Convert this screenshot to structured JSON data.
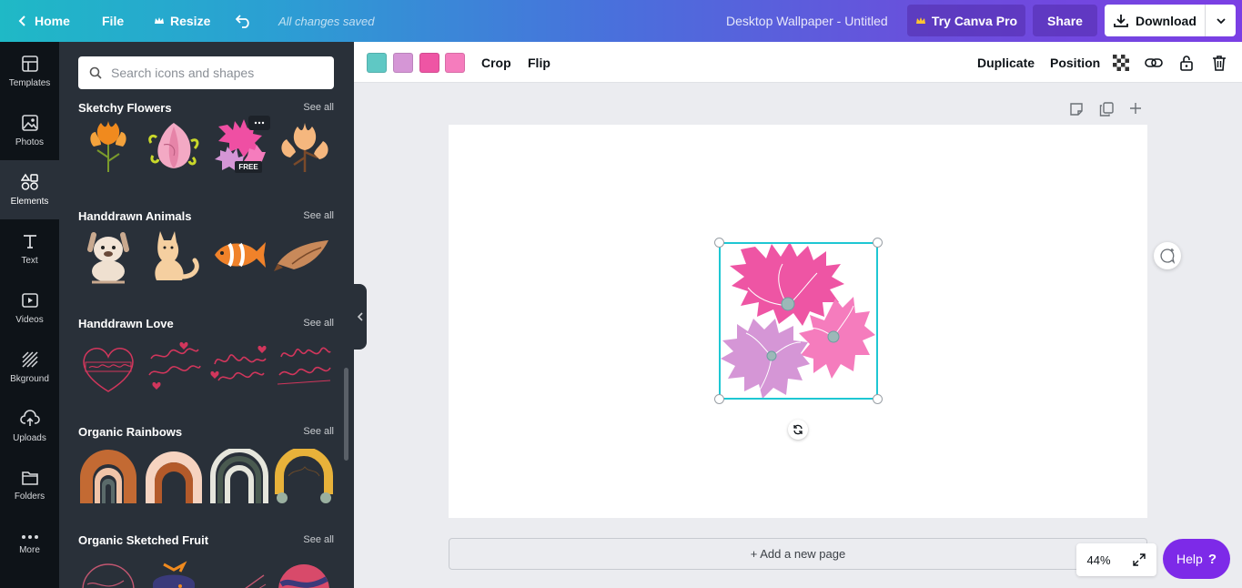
{
  "topbar": {
    "home_label": "Home",
    "file_label": "File",
    "resize_label": "Resize",
    "saved_status": "All changes saved",
    "doc_title": "Desktop Wallpaper - Untitled",
    "try_pro_label": "Try Canva Pro",
    "share_label": "Share",
    "download_label": "Download"
  },
  "rail": {
    "items": [
      {
        "label": "Templates",
        "icon": "templates-icon"
      },
      {
        "label": "Photos",
        "icon": "photos-icon"
      },
      {
        "label": "Elements",
        "icon": "elements-icon",
        "active": true
      },
      {
        "label": "Text",
        "icon": "text-icon"
      },
      {
        "label": "Videos",
        "icon": "videos-icon"
      },
      {
        "label": "Bkground",
        "icon": "background-icon"
      },
      {
        "label": "Uploads",
        "icon": "uploads-icon"
      },
      {
        "label": "Folders",
        "icon": "folders-icon"
      },
      {
        "label": "More",
        "icon": "more-icon"
      }
    ]
  },
  "panel": {
    "search_placeholder": "Search icons and shapes",
    "see_all_label": "See all",
    "free_badge": "FREE",
    "sections": [
      {
        "title": "Sketchy Flowers"
      },
      {
        "title": "Handdrawn Animals"
      },
      {
        "title": "Handdrawn Love"
      },
      {
        "title": "Organic Rainbows"
      },
      {
        "title": "Organic Sketched Fruit"
      }
    ]
  },
  "context_toolbar": {
    "swatches": [
      "#5fc8c4",
      "#d596d6",
      "#ee55a4",
      "#f57cbd"
    ],
    "crop_label": "Crop",
    "flip_label": "Flip",
    "duplicate_label": "Duplicate",
    "position_label": "Position"
  },
  "canvas": {
    "add_page_label": "+ Add a new page",
    "zoom_level": "44%"
  },
  "help": {
    "label": "Help",
    "glyph": "?"
  },
  "colors": {
    "accent_purple": "#7d2ae8",
    "selection": "#1ec7d3",
    "panel_bg": "#293039",
    "rail_bg": "#0e1318"
  }
}
